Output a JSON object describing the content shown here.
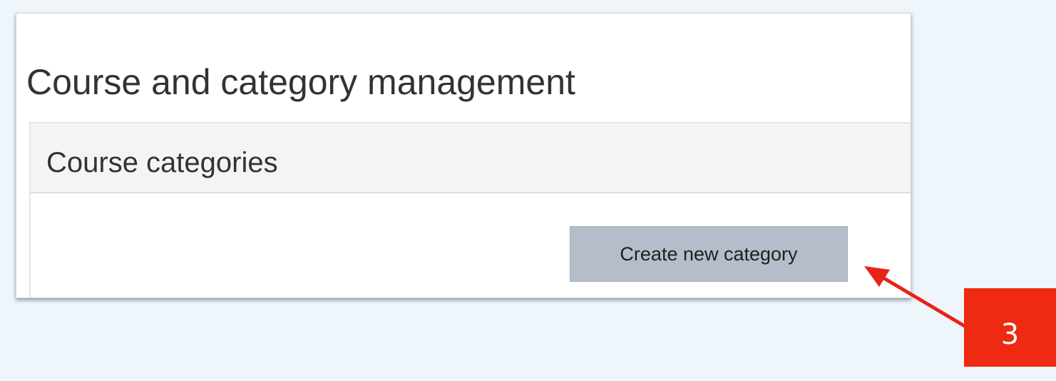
{
  "page": {
    "title": "Course and category management"
  },
  "card": {
    "title": "Course categories",
    "create_button_label": "Create new category"
  },
  "annotation": {
    "step_number": "3",
    "badge_color": "#ee2a12",
    "arrow_color": "#e8231a"
  },
  "colors": {
    "background": "#eef6fc",
    "button_bg": "#b5bdca",
    "header_bg": "#f4f4f4"
  }
}
